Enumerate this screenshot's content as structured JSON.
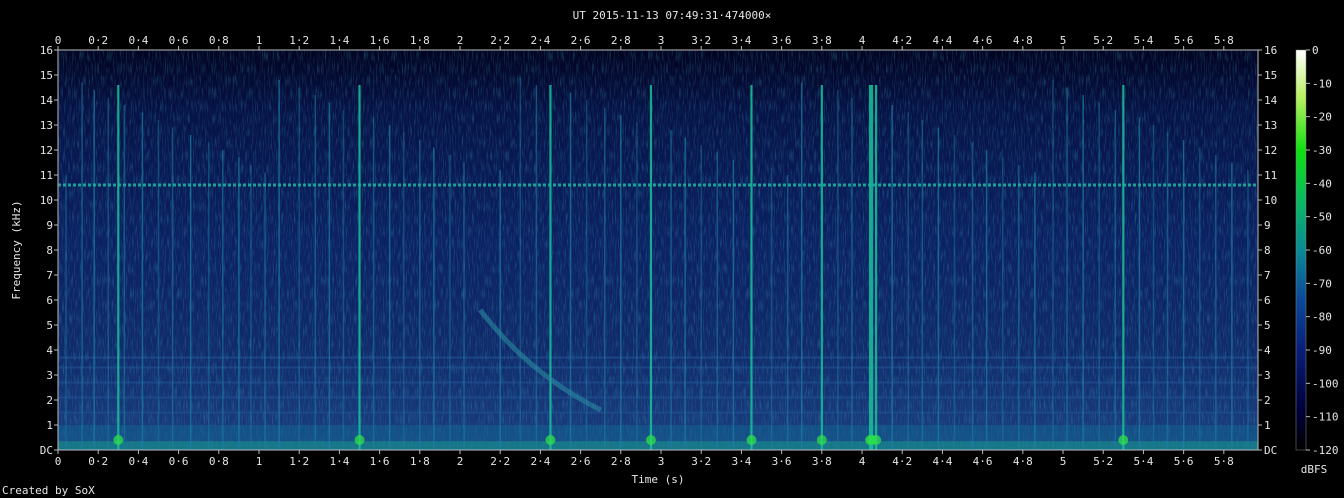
{
  "chart_data": {
    "type": "heatmap",
    "title": "UT 2015-11-13 07:49:31·474000×",
    "xlabel": "Time (s)",
    "ylabel": "Frequency (kHz)",
    "credit": "Created by SoX",
    "xlim": [
      0,
      5.97
    ],
    "ylim": [
      0,
      16
    ],
    "x_ticks": [
      "0",
      "0·2",
      "0·4",
      "0·6",
      "0·8",
      "1",
      "1·2",
      "1·4",
      "1·6",
      "1·8",
      "2",
      "2·2",
      "2·4",
      "2·6",
      "2·8",
      "3",
      "3·2",
      "3·4",
      "3·6",
      "3·8",
      "4",
      "4·2",
      "4·4",
      "4·6",
      "4·8",
      "5",
      "5·2",
      "5·4",
      "5·6",
      "5·8"
    ],
    "y_ticks": [
      "DC",
      "1",
      "2",
      "3",
      "4",
      "5",
      "6",
      "7",
      "8",
      "9",
      "10",
      "11",
      "12",
      "13",
      "14",
      "15",
      "16"
    ],
    "colorbar": {
      "unit": "dBFS",
      "range": [
        -120,
        0
      ],
      "ticks": [
        "0",
        "-10",
        "-20",
        "-30",
        "-40",
        "-50",
        "-60",
        "-70",
        "-80",
        "-90",
        "-100",
        "-110",
        "-120"
      ]
    },
    "horizontal_line_khz": 10.6,
    "sweep": {
      "t_start": 2.1,
      "f_start": 5.6,
      "t_end": 2.7,
      "f_end": 1.6
    },
    "strong_events_s": [
      0.3,
      1.5,
      2.45,
      2.95,
      3.45,
      3.8,
      4.04,
      4.05,
      4.07,
      5.3
    ],
    "impulses_s": [
      0.04,
      0.12,
      0.18,
      0.25,
      0.33,
      0.42,
      0.5,
      0.57,
      0.66,
      0.75,
      0.82,
      0.9,
      0.96,
      1.03,
      1.1,
      1.2,
      1.28,
      1.35,
      1.42,
      1.57,
      1.65,
      1.72,
      1.8,
      1.87,
      1.95,
      2.02,
      2.2,
      2.3,
      2.38,
      2.55,
      2.63,
      2.72,
      2.8,
      2.88,
      3.05,
      3.12,
      3.2,
      3.28,
      3.36,
      3.55,
      3.63,
      3.7,
      3.88,
      3.95,
      4.15,
      4.23,
      4.3,
      4.38,
      4.46,
      4.55,
      4.62,
      4.7,
      4.78,
      4.86,
      4.95,
      5.02,
      5.1,
      5.18,
      5.26,
      5.38,
      5.45,
      5.52,
      5.6,
      5.68,
      5.76,
      5.84,
      5.92
    ]
  }
}
